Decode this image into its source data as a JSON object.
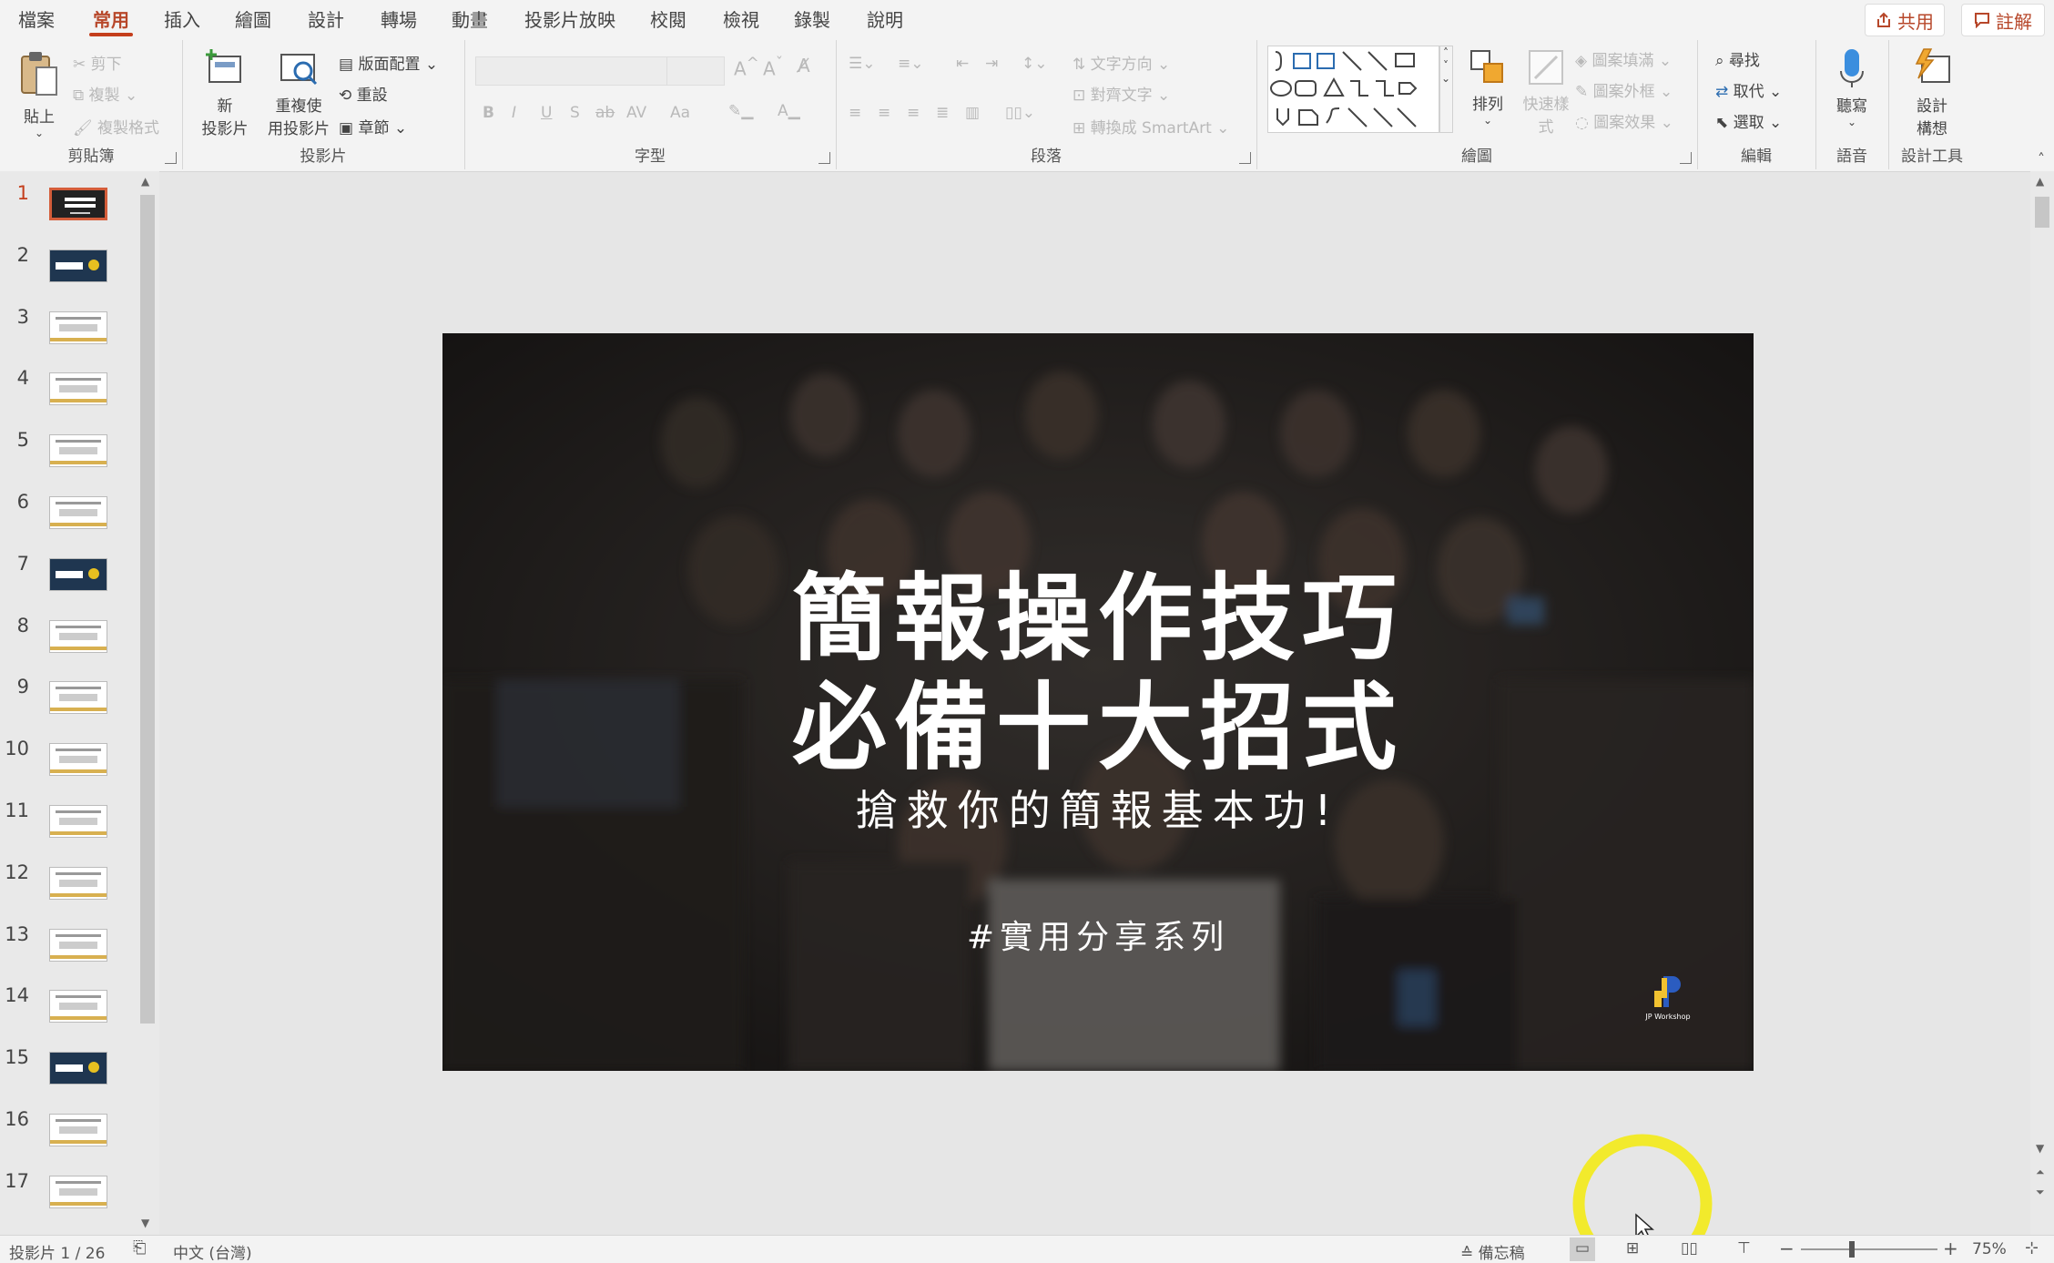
{
  "menu": {
    "tabs": [
      "檔案",
      "常用",
      "插入",
      "繪圖",
      "設計",
      "轉場",
      "動畫",
      "投影片放映",
      "校閱",
      "檢視",
      "錄製",
      "說明"
    ],
    "active_tab": "常用",
    "share_label": "共用",
    "comments_label": "註解"
  },
  "ribbon": {
    "clipboard": {
      "paste": "貼上",
      "cut": "剪下",
      "copy": "複製",
      "format_painter": "複製格式",
      "label": "剪貼簿"
    },
    "slides": {
      "new_slide_line1": "新",
      "new_slide_line2": "投影片",
      "reuse_line1": "重複使",
      "reuse_line2": "用投影片",
      "layout": "版面配置",
      "reset": "重設",
      "section": "章節",
      "label": "投影片"
    },
    "font": {
      "bold": "B",
      "italic": "I",
      "underline": "U",
      "shadow": "S",
      "strike": "ab",
      "spacing": "AV",
      "case": "Aa",
      "label": "字型"
    },
    "paragraph": {
      "text_direction": "文字方向",
      "align_text": "對齊文字",
      "smartart": "轉換成 SmartArt",
      "label": "段落"
    },
    "drawing": {
      "arrange": "排列",
      "quick_styles_line1": "快速樣",
      "quick_styles_line2": "式",
      "shape_fill": "圖案填滿",
      "shape_outline": "圖案外框",
      "shape_effects": "圖案效果",
      "label": "繪圖"
    },
    "editing": {
      "find": "尋找",
      "replace": "取代",
      "select": "選取",
      "label": "編輯"
    },
    "voice": {
      "dictate": "聽寫",
      "label": "語音"
    },
    "designer": {
      "line1": "設計",
      "line2": "構想",
      "label": "設計工具"
    }
  },
  "thumbnails": [
    {
      "num": "1",
      "style": "black"
    },
    {
      "num": "2",
      "style": "dark"
    },
    {
      "num": "3",
      "style": "light"
    },
    {
      "num": "4",
      "style": "light"
    },
    {
      "num": "5",
      "style": "light"
    },
    {
      "num": "6",
      "style": "light"
    },
    {
      "num": "7",
      "style": "dark"
    },
    {
      "num": "8",
      "style": "light"
    },
    {
      "num": "9",
      "style": "light"
    },
    {
      "num": "10",
      "style": "light"
    },
    {
      "num": "11",
      "style": "light"
    },
    {
      "num": "12",
      "style": "light"
    },
    {
      "num": "13",
      "style": "light"
    },
    {
      "num": "14",
      "style": "light"
    },
    {
      "num": "15",
      "style": "dark"
    },
    {
      "num": "16",
      "style": "light"
    },
    {
      "num": "17",
      "style": "light"
    }
  ],
  "slide": {
    "title_line1": "簡報操作技巧",
    "title_line2": "必備十大招式",
    "subtitle": "搶救你的簡報基本功!",
    "hashtag": "#實用分享系列",
    "logo_text": "JP Workshop"
  },
  "status": {
    "slide_counter": "投影片 1 / 26",
    "language": "中文 (台灣)",
    "notes": "備忘稿",
    "zoom": "75%",
    "zoom_level": 0.75
  },
  "colors": {
    "accent": "#c43e1c",
    "cursor_highlight": "#f2ea2c",
    "slide_bg": "#2a2624"
  }
}
